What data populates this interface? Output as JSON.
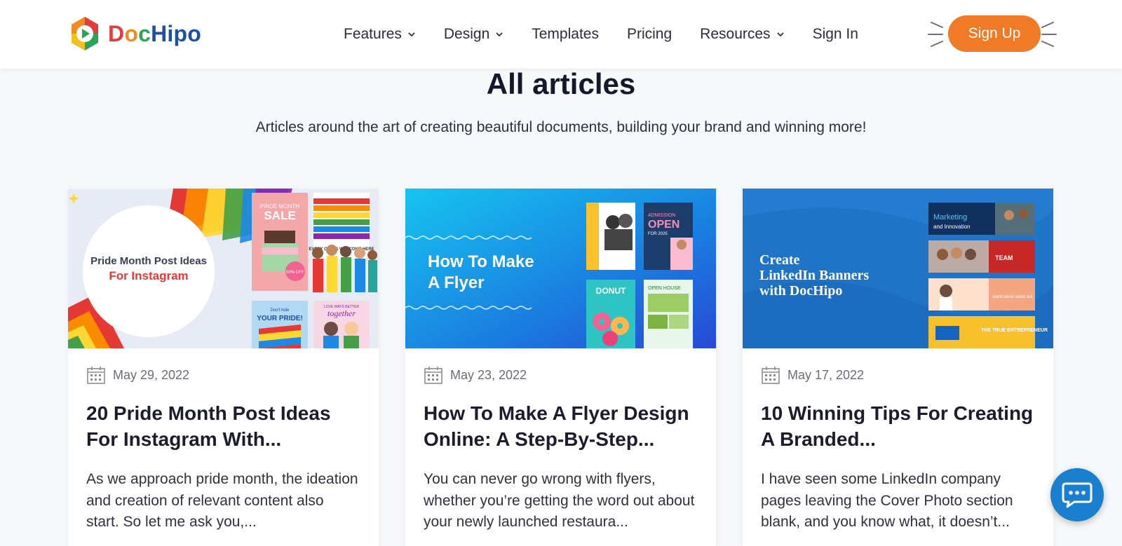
{
  "brand": {
    "logo_text": [
      "D",
      "o",
      "c",
      "Hipo"
    ]
  },
  "nav": {
    "features": "Features",
    "design": "Design",
    "templates": "Templates",
    "pricing": "Pricing",
    "resources": "Resources",
    "sign_in": "Sign In",
    "sign_up": "Sign Up"
  },
  "colors": {
    "accent": "#f07a26",
    "chat": "#1a7fcf",
    "title": "#15172a"
  },
  "hero": {
    "title": "All articles",
    "subtitle": "Articles around the art of creating beautiful documents, building your brand and winning more!"
  },
  "articles": [
    {
      "date": "May 29, 2022",
      "title": "20 Pride Month Post Ideas For Instagram With...",
      "excerpt": "As we approach pride month, the ideation and creation of relevant content also start. So let me ask you,...",
      "thumb": {
        "line1": "Pride Month Post Ideas",
        "line2": "For Instagram",
        "sale_top": "PRIDE MONTH",
        "sale": "SALE",
        "sale_off": "50% OFF",
        "poster": "EVERY ONE IS WELCOME HERE",
        "pride_top": "Don't hide",
        "pride": "YOUR PRIDE!",
        "together_top": "LOVE WAYS BETTER",
        "together": "together"
      }
    },
    {
      "date": "May 23, 2022",
      "title": "How To Make A Flyer Design Online: A Step-By-Step...",
      "excerpt": "You can never go wrong with flyers, whether you’re getting the word out about your newly launched restaura...",
      "thumb": {
        "line1": "How To Make",
        "line2": "A Flyer",
        "admission": "ADMISSION",
        "open": "OPEN",
        "year": "FOR 2025",
        "donut": "DONUT",
        "open_house": "OPEN HOUSE"
      }
    },
    {
      "date": "May 17, 2022",
      "title": "10 Winning Tips For Creating A Branded...",
      "excerpt": "I have seen some LinkedIn company pages leaving the Cover Photo section blank, and you know what, it doesn’t...",
      "thumb": {
        "line1": "Create",
        "line2": "LinkedIn Banners",
        "line3": "with DocHipo",
        "b1": "Marketing",
        "b1b": "and Innovation",
        "b2": "TEAM",
        "b3": "stand alone stand out",
        "b4": "THE TRUE ENTREPRENEUR"
      }
    }
  ]
}
